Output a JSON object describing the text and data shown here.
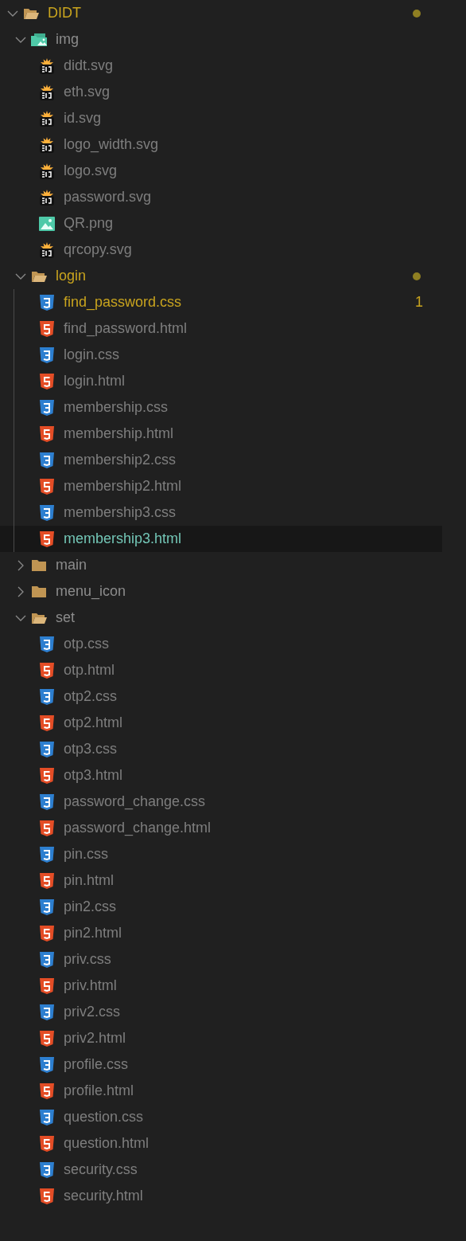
{
  "explorer": {
    "tree": [
      {
        "name": "DIDT",
        "kind": "folder",
        "expanded": true,
        "modified": true,
        "selected": false,
        "children": [
          {
            "name": "img",
            "kind": "image_folder",
            "expanded": true,
            "modified": false,
            "selected": false,
            "children": [
              {
                "name": "didt.svg",
                "kind": "svg",
                "modified": false,
                "selected": false
              },
              {
                "name": "eth.svg",
                "kind": "svg",
                "modified": false,
                "selected": false
              },
              {
                "name": "id.svg",
                "kind": "svg",
                "modified": false,
                "selected": false
              },
              {
                "name": "logo_width.svg",
                "kind": "svg",
                "modified": false,
                "selected": false
              },
              {
                "name": "logo.svg",
                "kind": "svg",
                "modified": false,
                "selected": false
              },
              {
                "name": "password.svg",
                "kind": "svg",
                "modified": false,
                "selected": false
              },
              {
                "name": "QR.png",
                "kind": "png",
                "modified": false,
                "selected": false
              },
              {
                "name": "qrcopy.svg",
                "kind": "svg",
                "modified": false,
                "selected": false
              }
            ]
          },
          {
            "name": "login",
            "kind": "folder",
            "expanded": true,
            "modified": true,
            "selected": false,
            "children": [
              {
                "name": "find_password.css",
                "kind": "css",
                "modified": true,
                "problems": "1",
                "selected": false
              },
              {
                "name": "find_password.html",
                "kind": "html",
                "modified": false,
                "selected": false
              },
              {
                "name": "login.css",
                "kind": "css",
                "modified": false,
                "selected": false
              },
              {
                "name": "login.html",
                "kind": "html",
                "modified": false,
                "selected": false
              },
              {
                "name": "membership.css",
                "kind": "css",
                "modified": false,
                "selected": false
              },
              {
                "name": "membership.html",
                "kind": "html",
                "modified": false,
                "selected": false
              },
              {
                "name": "membership2.css",
                "kind": "css",
                "modified": false,
                "selected": false
              },
              {
                "name": "membership2.html",
                "kind": "html",
                "modified": false,
                "selected": false
              },
              {
                "name": "membership3.css",
                "kind": "css",
                "modified": false,
                "selected": false
              },
              {
                "name": "membership3.html",
                "kind": "html",
                "modified": false,
                "selected": true
              }
            ]
          },
          {
            "name": "main",
            "kind": "folder",
            "expanded": false,
            "modified": false,
            "selected": false
          },
          {
            "name": "menu_icon",
            "kind": "folder",
            "expanded": false,
            "modified": false,
            "selected": false
          },
          {
            "name": "set",
            "kind": "folder",
            "expanded": true,
            "modified": false,
            "selected": false,
            "children": [
              {
                "name": "otp.css",
                "kind": "css",
                "modified": false,
                "selected": false
              },
              {
                "name": "otp.html",
                "kind": "html",
                "modified": false,
                "selected": false
              },
              {
                "name": "otp2.css",
                "kind": "css",
                "modified": false,
                "selected": false
              },
              {
                "name": "otp2.html",
                "kind": "html",
                "modified": false,
                "selected": false
              },
              {
                "name": "otp3.css",
                "kind": "css",
                "modified": false,
                "selected": false
              },
              {
                "name": "otp3.html",
                "kind": "html",
                "modified": false,
                "selected": false
              },
              {
                "name": "password_change.css",
                "kind": "css",
                "modified": false,
                "selected": false
              },
              {
                "name": "password_change.html",
                "kind": "html",
                "modified": false,
                "selected": false
              },
              {
                "name": "pin.css",
                "kind": "css",
                "modified": false,
                "selected": false
              },
              {
                "name": "pin.html",
                "kind": "html",
                "modified": false,
                "selected": false
              },
              {
                "name": "pin2.css",
                "kind": "css",
                "modified": false,
                "selected": false
              },
              {
                "name": "pin2.html",
                "kind": "html",
                "modified": false,
                "selected": false
              },
              {
                "name": "priv.css",
                "kind": "css",
                "modified": false,
                "selected": false
              },
              {
                "name": "priv.html",
                "kind": "html",
                "modified": false,
                "selected": false
              },
              {
                "name": "priv2.css",
                "kind": "css",
                "modified": false,
                "selected": false
              },
              {
                "name": "priv2.html",
                "kind": "html",
                "modified": false,
                "selected": false
              },
              {
                "name": "profile.css",
                "kind": "css",
                "modified": false,
                "selected": false
              },
              {
                "name": "profile.html",
                "kind": "html",
                "modified": false,
                "selected": false
              },
              {
                "name": "question.css",
                "kind": "css",
                "modified": false,
                "selected": false
              },
              {
                "name": "question.html",
                "kind": "html",
                "modified": false,
                "selected": false
              },
              {
                "name": "security.css",
                "kind": "css",
                "modified": false,
                "selected": false
              },
              {
                "name": "security.html",
                "kind": "html",
                "modified": false,
                "selected": false
              }
            ]
          }
        ]
      }
    ]
  }
}
